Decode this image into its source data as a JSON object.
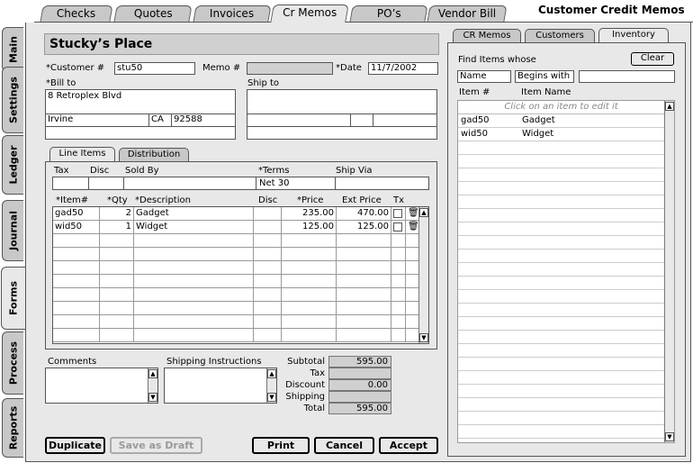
{
  "top_tabs": [
    "Checks",
    "Quotes",
    "Invoices",
    "Cr Memos",
    "PO’s",
    "Vendor Bill"
  ],
  "window_title": "Customer Credit Memos",
  "side_tabs": [
    "Main",
    "Settings",
    "Ledger",
    "Journal",
    "Forms",
    "Process",
    "Reports"
  ],
  "form": {
    "customer_name": "Stucky’s Place",
    "customer_label": "*Customer #",
    "customer_value": "stu50",
    "memo_label": "Memo #",
    "memo_value": "",
    "date_label": "*Date",
    "date_value": "11/7/2002",
    "bill_to_label": "*Bill to",
    "bill_to_line1": "8 Retroplex Blvd",
    "bill_city": "Irvine",
    "bill_state": "CA",
    "bill_zip": "92588",
    "ship_to_label": "Ship to"
  },
  "sub_tabs": [
    "Line Items",
    "Distribution"
  ],
  "terms_headers": {
    "tax": "Tax",
    "disc": "Disc",
    "sold_by": "Sold By",
    "terms": "*Terms",
    "ship_via": "Ship Via"
  },
  "terms_value": "Net 30",
  "line_headers": {
    "item": "*Item#",
    "qty": "*Qty",
    "desc": "*Description",
    "disc": "Disc",
    "price": "*Price",
    "ext": "Ext Price",
    "tx": "Tx"
  },
  "line_items": [
    {
      "item": "gad50",
      "qty": "2",
      "desc": "Gadget",
      "price": "235.00",
      "ext": "470.00"
    },
    {
      "item": "wid50",
      "qty": "1",
      "desc": "Widget",
      "price": "125.00",
      "ext": "125.00"
    }
  ],
  "comments_label": "Comments",
  "shipping_label": "Shipping Instructions",
  "totals": {
    "subtotal_label": "Subtotal",
    "subtotal": "595.00",
    "tax_label": "Tax",
    "tax": "",
    "discount_label": "Discount",
    "discount": "0.00",
    "shipping_label": "Shipping",
    "shipping": "",
    "total_label": "Total",
    "total": "595.00"
  },
  "buttons": {
    "duplicate": "Duplicate",
    "save_draft": "Save as Draft",
    "print": "Print",
    "cancel": "Cancel",
    "accept": "Accept"
  },
  "right_tabs": [
    "CR Memos",
    "Customers",
    "Inventory"
  ],
  "find": {
    "label": "Find Items whose",
    "clear": "Clear",
    "field": "Name",
    "op": "Begins with",
    "value": ""
  },
  "inv_headers": {
    "item": "Item #",
    "name": "Item Name"
  },
  "inv_hint": "Click on an item to edit it",
  "inventory": [
    {
      "item": "gad50",
      "name": "Gadget"
    },
    {
      "item": "wid50",
      "name": "Widget"
    }
  ],
  "colors": {
    "tab_bg": "#c8c8c8",
    "panel_bg": "#e8e8e8",
    "readonly_bg": "#d0d0d0"
  }
}
